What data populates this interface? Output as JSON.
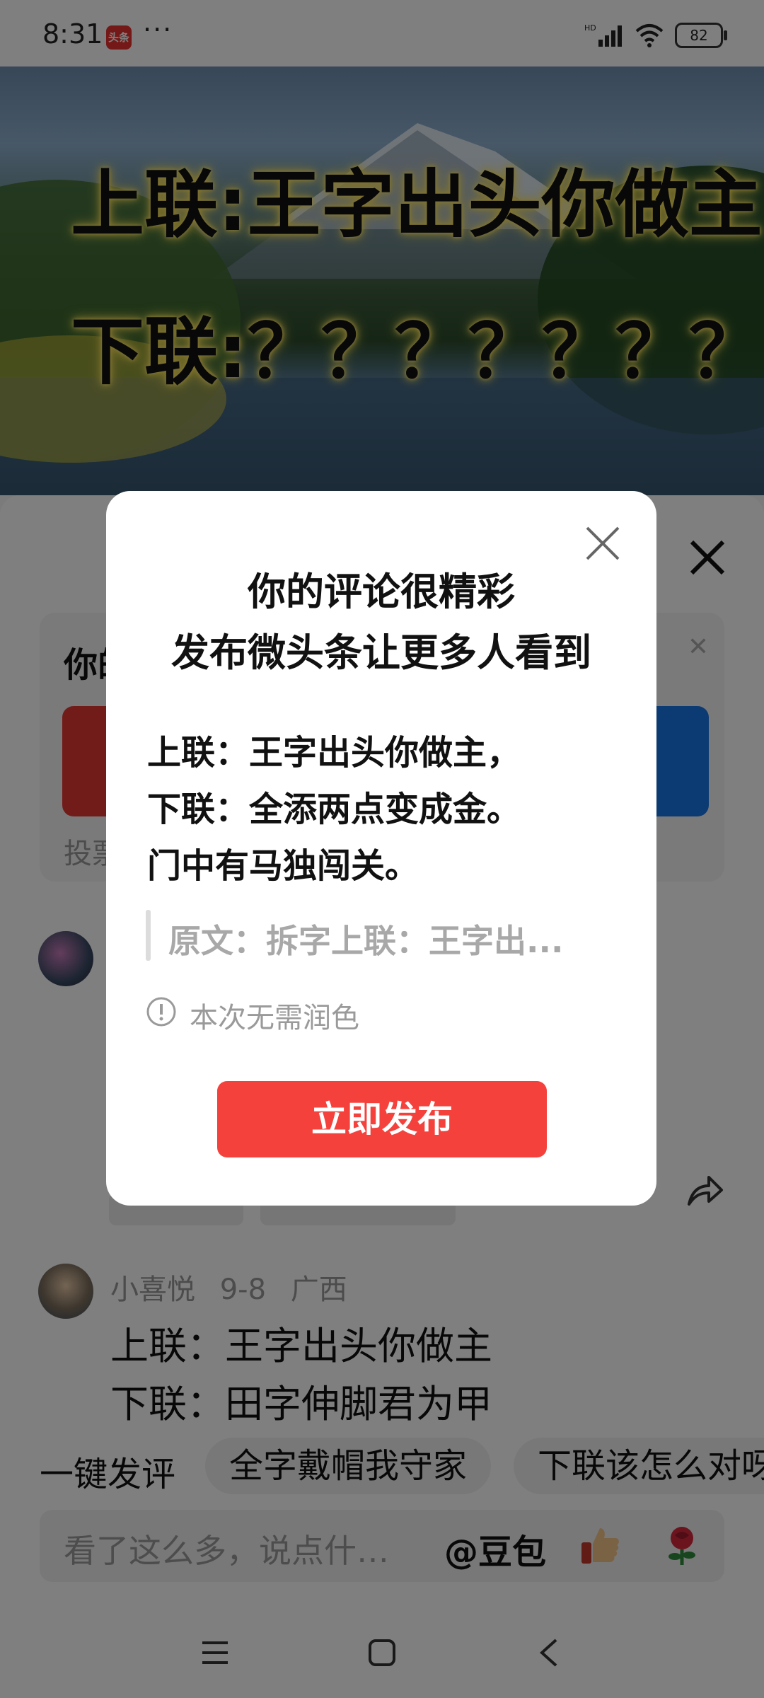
{
  "status_bar": {
    "time": "8:31",
    "app_badge": "头条",
    "more": "···",
    "network": "HD",
    "battery": "82"
  },
  "hero": {
    "line1": "上联:王字出头你做主",
    "line2": "下联:？？？？？？？"
  },
  "sheet": {
    "vote_title": "你的",
    "vote_footer": "投票",
    "comment2": {
      "user": "小喜悦",
      "date": "9-8",
      "region": "广西",
      "line1": "上联：王字出头你做主",
      "line2": "下联：田字伸脚君为甲"
    },
    "quick_label": "一键发评",
    "quick_chips": [
      "全字戴帽我守家",
      "下联该怎么对呀"
    ],
    "input_placeholder": "看了这么多，说点什…",
    "input_mention": "@豆包",
    "input_emojis": [
      "thumbs-up-icon",
      "rose-icon"
    ]
  },
  "modal": {
    "title_line1": "你的评论很精彩",
    "title_line2": "发布微头条让更多人看到",
    "body_lines": [
      "上联：王字出头你做主，",
      "下联：全添两点变成金。",
      "门中有马独闯关。"
    ],
    "quote": "原文：拆字上联：王字出...",
    "hint": "本次无需润色",
    "publish_button": "立即发布"
  },
  "colors": {
    "publish": "#f5413c",
    "vote_red": "#e53935",
    "vote_blue": "#1976e6",
    "overlay": "rgba(0,0,0,0.5)"
  }
}
